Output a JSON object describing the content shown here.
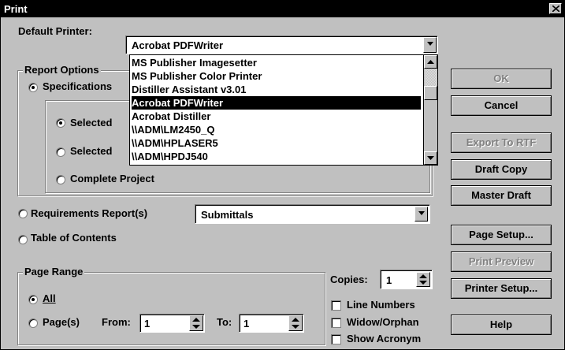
{
  "window": {
    "title": "Print"
  },
  "default_printer": {
    "label": "Default Printer:",
    "value": "Acrobat PDFWriter",
    "options": [
      "MS Publisher Imagesetter",
      "MS Publisher Color Printer",
      "Distiller Assistant v3.01",
      "Acrobat PDFWriter",
      "Acrobat Distiller",
      "\\\\ADM\\LM2450_Q",
      "\\\\ADM\\HPLASER5",
      "\\\\ADM\\HPDJ540"
    ],
    "selected_index": 3
  },
  "report_options": {
    "title": "Report Options",
    "specifications": "Specifications",
    "selected_1": "Selected",
    "selected_2": "Selected",
    "complete_project": "Complete Project",
    "requirements": "Requirements Report(s)",
    "requirements_value": "Submittals",
    "toc": "Table of Contents"
  },
  "page_range": {
    "title": "Page Range",
    "all": "All",
    "pages": "Page(s)",
    "from_label": "From:",
    "from_value": "1",
    "to_label": "To:",
    "to_value": "1"
  },
  "copies": {
    "label": "Copies:",
    "value": "1"
  },
  "checks": {
    "line_numbers": "Line Numbers",
    "widow_orphan": "Widow/Orphan",
    "show_acronym": "Show Acronym"
  },
  "buttons": {
    "ok": "OK",
    "cancel": "Cancel",
    "export_rtf": "Export To RTF",
    "draft_copy": "Draft Copy",
    "master_draft": "Master Draft",
    "page_setup": "Page Setup...",
    "print_preview": "Print Preview",
    "printer_setup": "Printer Setup...",
    "help": "Help"
  },
  "icons": {
    "close": "close-icon",
    "dropdown": "dropdown-arrow-icon",
    "spin": "spin-arrows-icon",
    "scroll_up": "scroll-up-icon",
    "scroll_down": "scroll-down-icon"
  }
}
